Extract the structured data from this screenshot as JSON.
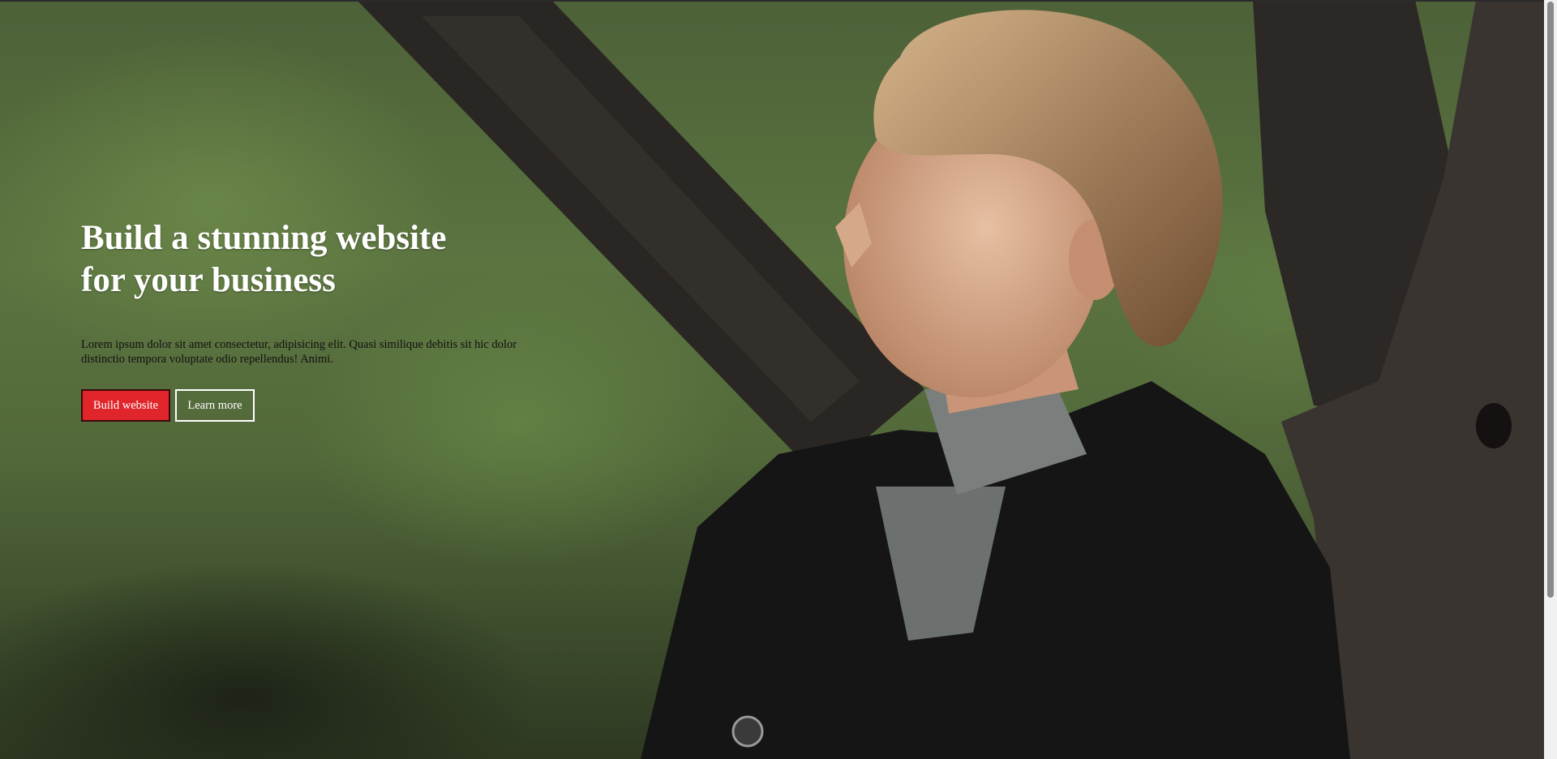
{
  "hero": {
    "title_line1": "Build a stunning website",
    "title_line2": "for your business",
    "text": "Lorem ipsum dolor sit amet consectetur, adipisicing elit. Quasi similique debitis sit hic dolor distinctio tempora voluptate odio repellendus! Animi.",
    "primary_button": "Build website",
    "secondary_button": "Learn more"
  },
  "colors": {
    "accent": "#e0262b",
    "text": "#ffffff"
  }
}
